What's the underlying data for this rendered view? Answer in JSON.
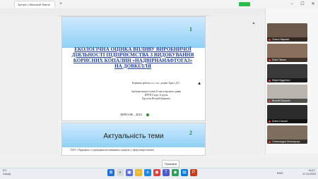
{
  "browser": {
    "tab_title": "Зустріч | Microsoft Teams",
    "new_tab_icon": "plus-icon",
    "window_controls": [
      "minimize-icon",
      "maximize-icon",
      "close-icon"
    ]
  },
  "slides": [
    {
      "number": "1",
      "title": "ЕКОЛОГІЧНА ОЦІНКА ВПЛИВУ ВИРОБНИЧОЇ ДІЯЛЬНОСТІ ПІДПРИЄМСТВА З ВИДОБУВАННЯ КОРИСНИХ КОПАЛИН «НАДВІРНАНАФТОГАЗ» НА ДОВКІЛЛЯ",
      "supervisor": "Керівник роботи: к.с.-г.н., доцент Бреус Д.С.",
      "degree": "Здобувач вищої освіти II магістерського рівня",
      "group": "ФРГН 6 курс II група",
      "author": "Бірсулін Віталій Іванович",
      "city_year": "ХЕРСОН – 2023"
    },
    {
      "number": "2",
      "title": "Актуальність теми",
      "body": "ПАТ «Укрнафта» є провідним вітчизняним лідером у сфері енергетичної"
    }
  ],
  "participants": [
    {
      "name": "Ольга Уварова",
      "bg": "#6d5a4d"
    },
    {
      "name": "Юлія Пікало",
      "bg": "#8a6f5c"
    },
    {
      "name": "Марія Кудренко",
      "bg": "#3a3a3a"
    },
    {
      "name": "Віталій Бірсулін",
      "bg": "#b9b4ad"
    },
    {
      "name": "Аліна Сокоян",
      "bg": "#2c2c2c"
    },
    {
      "name": "Олександра Шлюсарчук",
      "bg": "#7e6e5f"
    }
  ],
  "tooltip": "Показати",
  "taskbar": {
    "temperature": "6°C",
    "weather": "Cloudy",
    "tray": "ENG",
    "time": "14:17",
    "date": "17.11.2023"
  },
  "colors": {
    "slide_band": "#8fd0f5",
    "title_blue": "#1f3f8f",
    "slide_number": "#227f3c",
    "active_indicator": "#2bbd4b"
  }
}
